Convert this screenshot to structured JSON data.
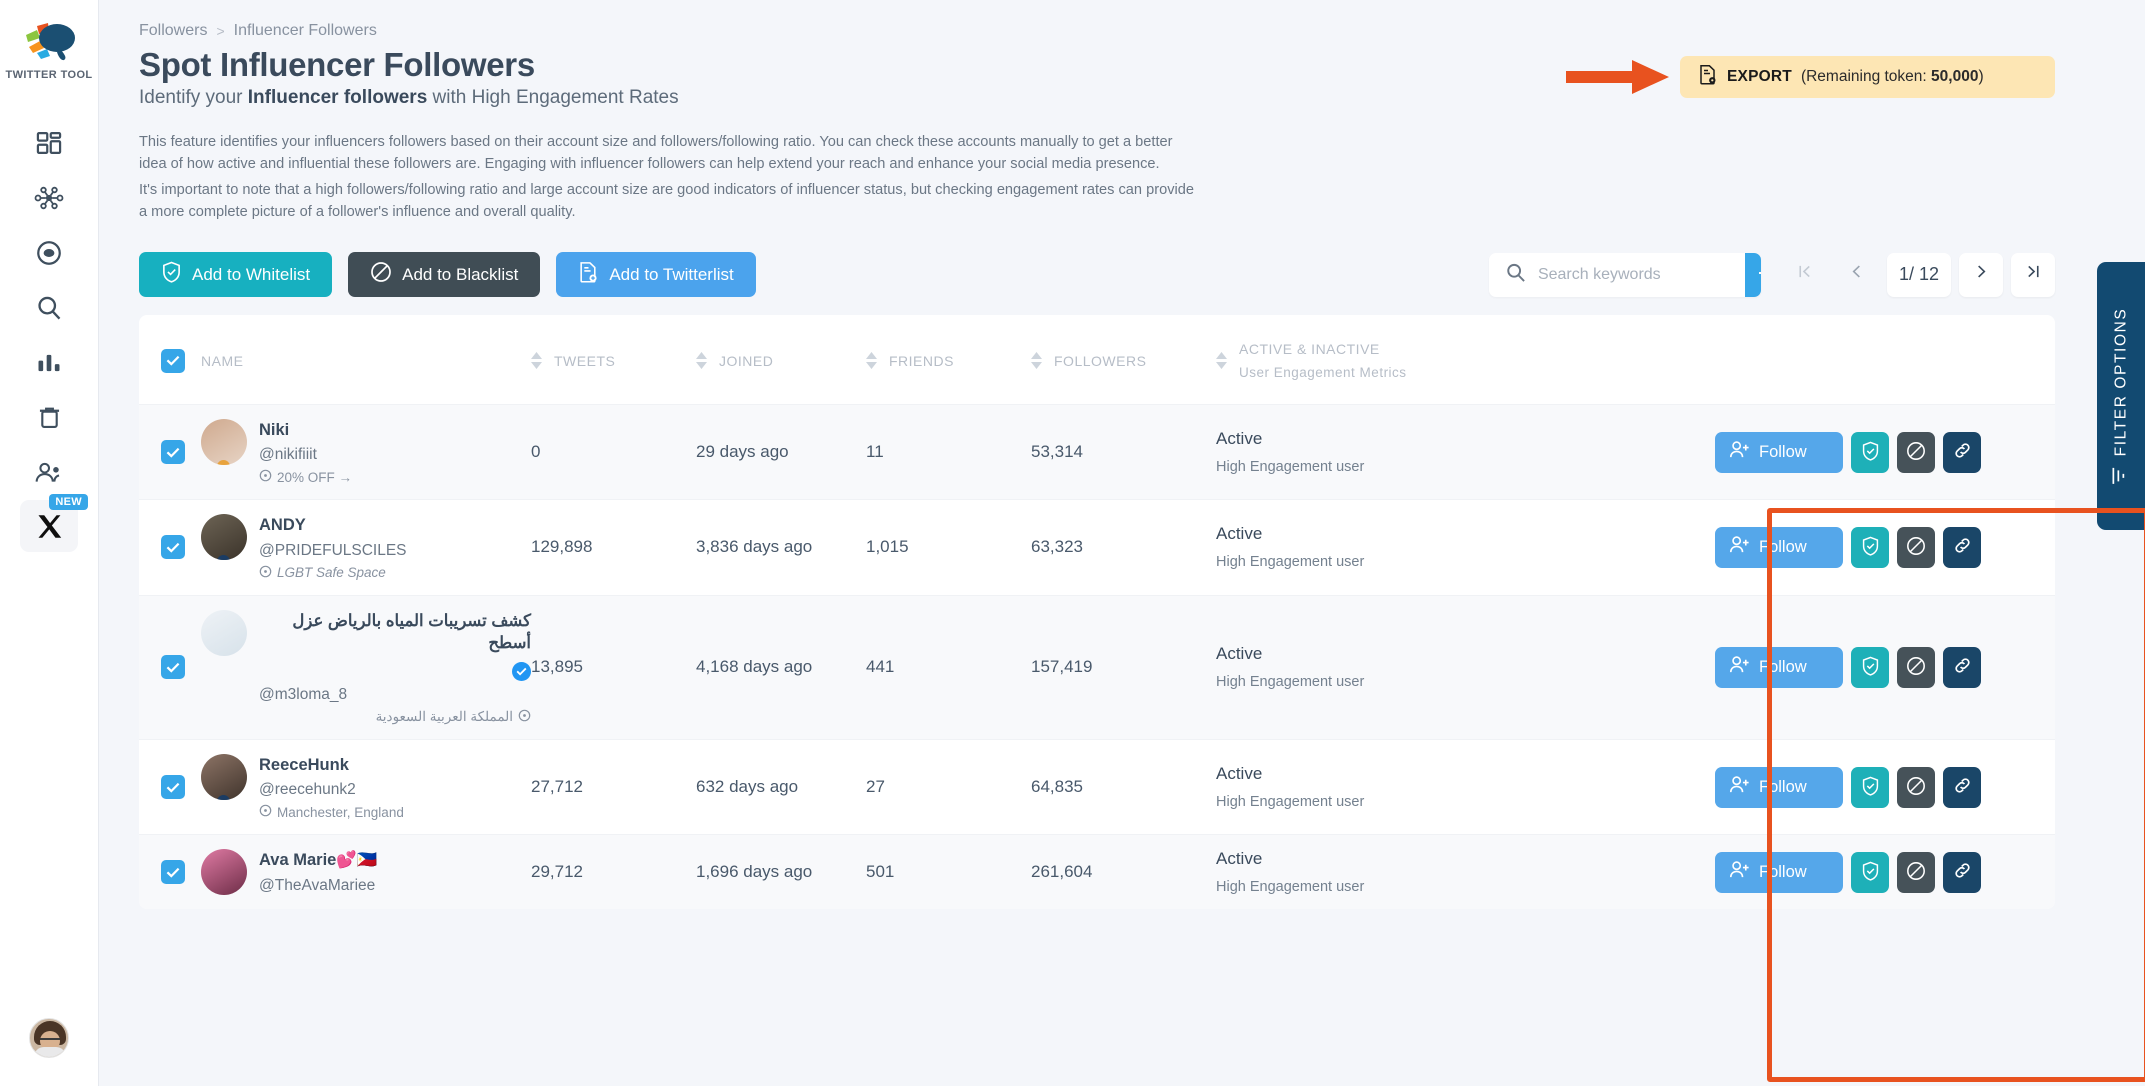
{
  "sidebar": {
    "brand_name": "TWITTER TOOL",
    "items": [
      {
        "name": "dashboard",
        "icon": "dashboard-icon"
      },
      {
        "name": "network",
        "icon": "network-icon"
      },
      {
        "name": "target",
        "icon": "target-icon"
      },
      {
        "name": "search",
        "icon": "search-icon"
      },
      {
        "name": "analytics",
        "icon": "bar-chart-icon"
      },
      {
        "name": "trash",
        "icon": "trash-icon"
      },
      {
        "name": "followers",
        "icon": "people-icon"
      },
      {
        "name": "x-platform",
        "icon": "x-logo-icon",
        "badge": "NEW"
      }
    ]
  },
  "breadcrumb": {
    "parent": "Followers",
    "separator": ">",
    "current": "Influencer Followers"
  },
  "header": {
    "title": "Spot Influencer Followers",
    "subtitle_pre": "Identify your ",
    "subtitle_bold": "Influencer followers",
    "subtitle_post": " with High Engagement Rates",
    "description_1": "This feature identifies your influencers followers based on their account size and followers/following ratio. You can check these accounts manually to get a better idea of how active and influential these followers are. Engaging with influencer followers can help extend your reach and enhance your social media presence.",
    "description_2": "It's important to note that a high followers/following ratio and large account size are good indicators of influencer status, but checking engagement rates can provide a more complete picture of a follower's influence and overall quality."
  },
  "export": {
    "label": "EXPORT",
    "remaining_pre": "(Remaining token: ",
    "remaining_value": "50,000",
    "remaining_post": ")",
    "bg_color": "#fde6b4",
    "arrow_color": "#e8521f"
  },
  "toolbar": {
    "whitelist_label": "Add to Whitelist",
    "blacklist_label": "Add to Blacklist",
    "twitterlist_label": "Add to Twitterlist",
    "whitelist_color": "#17b0c0",
    "blacklist_color": "#404d55",
    "twitterlist_color": "#4ba3ed"
  },
  "search": {
    "placeholder": "Search keywords",
    "value": "",
    "go_icon": "arrow-right-icon"
  },
  "pagination": {
    "first": "|<",
    "prev": "<",
    "current": "1/ 12",
    "next": ">",
    "last": ">|",
    "page": 1,
    "total_pages": 12
  },
  "table": {
    "columns": [
      {
        "key": "name",
        "label": "NAME",
        "sortable": true
      },
      {
        "key": "tweets",
        "label": "TWEETS",
        "sortable": true
      },
      {
        "key": "joined",
        "label": "JOINED",
        "sortable": true
      },
      {
        "key": "friends",
        "label": "FRIENDS",
        "sortable": true
      },
      {
        "key": "followers",
        "label": "FOLLOWERS",
        "sortable": true
      }
    ],
    "active_col": {
      "title": "ACTIVE & INACTIVE",
      "subtitle": "User Engagement Metrics"
    },
    "header_checkbox_checked": true,
    "rows": [
      {
        "checked": true,
        "name": "Niki",
        "handle": "@nikifiiit",
        "location": "20% OFF →",
        "location_italic": false,
        "rtl": false,
        "verified": false,
        "tweets": "0",
        "joined": "29 days ago",
        "friends": "11",
        "followers": "53,314",
        "status": "Active",
        "engagement": "High Engagement user",
        "avatar_colors": [
          "#cfa98e",
          "#e7d4c5"
        ],
        "dot_color": "#e8a33d"
      },
      {
        "checked": true,
        "name": "ANDY",
        "handle": "@PRIDEFULSCILES",
        "location": "LGBT Safe Space",
        "location_italic": true,
        "rtl": false,
        "verified": false,
        "tweets": "129,898",
        "joined": "3,836 days ago",
        "friends": "1,015",
        "followers": "63,323",
        "status": "Active",
        "engagement": "High Engagement user",
        "avatar_colors": [
          "#6d6455",
          "#3b332a"
        ],
        "dot_color": "#1b3c63"
      },
      {
        "checked": true,
        "name": "كشف تسريبات المياه بالرياض عزل أسطح",
        "handle": "@m3loma_8",
        "location": "المملكة العربية السعودية",
        "location_italic": false,
        "rtl": true,
        "verified": true,
        "tweets": "13,895",
        "joined": "4,168 days ago",
        "friends": "441",
        "followers": "157,419",
        "status": "Active",
        "engagement": "High Engagement user",
        "avatar_colors": [
          "#eef2f6",
          "#d7e2ea"
        ],
        "dot_color": ""
      },
      {
        "checked": true,
        "name": "ReeceHunk",
        "handle": "@reecehunk2",
        "location": "Manchester, England",
        "location_italic": false,
        "rtl": false,
        "verified": false,
        "tweets": "27,712",
        "joined": "632 days ago",
        "friends": "27",
        "followers": "64,835",
        "status": "Active",
        "engagement": "High Engagement user",
        "avatar_colors": [
          "#8d7466",
          "#40342c"
        ],
        "dot_color": "#1b3c63"
      },
      {
        "checked": true,
        "name": "Ava Marie💕🇵🇭",
        "handle": "@TheAvaMariee",
        "location": "",
        "location_italic": false,
        "rtl": false,
        "verified": false,
        "tweets": "29,712",
        "joined": "1,696 days ago",
        "friends": "501",
        "followers": "261,604",
        "status": "Active",
        "engagement": "High Engagement user",
        "avatar_colors": [
          "#e07ba4",
          "#6d2d47"
        ],
        "dot_color": ""
      }
    ],
    "row_actions": {
      "follow_label": "Follow",
      "follow_icon": "user-plus-icon",
      "whitelist_icon": "shield-check-icon",
      "blacklist_icon": "ban-icon",
      "link_icon": "link-icon",
      "follow_color": "#55a7ea",
      "whitelist_color": "#1eb0b8",
      "blacklist_color": "#465259",
      "link_color": "#1a4668"
    },
    "highlight_color": "#e8521f"
  },
  "filter_tab": {
    "label": "FILTER OPTIONS",
    "icon": "filter-icon",
    "color": "#124a71"
  }
}
